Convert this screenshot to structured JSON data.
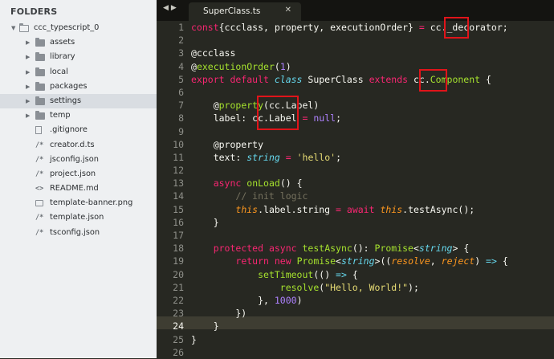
{
  "sidebar": {
    "header": "FOLDERS",
    "items": [
      {
        "label": "ccc_typescript_0",
        "kind": "folder-open",
        "icon": "folder-open-icon"
      },
      {
        "label": "assets",
        "kind": "folder",
        "icon": "folder-icon"
      },
      {
        "label": "library",
        "kind": "folder",
        "icon": "folder-icon"
      },
      {
        "label": "local",
        "kind": "folder",
        "icon": "folder-icon"
      },
      {
        "label": "packages",
        "kind": "folder",
        "icon": "folder-icon"
      },
      {
        "label": "settings",
        "kind": "folder",
        "icon": "folder-icon",
        "selected": true
      },
      {
        "label": "temp",
        "kind": "folder",
        "icon": "folder-icon"
      },
      {
        "label": ".gitignore",
        "kind": "file",
        "glyph": "",
        "icon": "file-icon"
      },
      {
        "label": "creator.d.ts",
        "kind": "file",
        "glyph": "/*",
        "icon": "code-file-icon"
      },
      {
        "label": "jsconfig.json",
        "kind": "file",
        "glyph": "/*",
        "icon": "code-file-icon"
      },
      {
        "label": "project.json",
        "kind": "file",
        "glyph": "/*",
        "icon": "code-file-icon"
      },
      {
        "label": "README.md",
        "kind": "file",
        "glyph": "<>",
        "icon": "markup-file-icon"
      },
      {
        "label": "template-banner.png",
        "kind": "image",
        "icon": "image-file-icon"
      },
      {
        "label": "template.json",
        "kind": "file",
        "glyph": "/*",
        "icon": "code-file-icon"
      },
      {
        "label": "tsconfig.json",
        "kind": "file",
        "glyph": "/*",
        "icon": "code-file-icon"
      }
    ]
  },
  "tabbar": {
    "nav_left": "◀",
    "nav_right": "▶",
    "active_tab": {
      "title": "SuperClass.ts",
      "close": "✕"
    }
  },
  "editor": {
    "current_line": 24,
    "highlight_color": "#e0141a",
    "lines": [
      [
        [
          "kw",
          "const"
        ],
        [
          "",
          "{ccclass, property, executionOrder} "
        ],
        [
          "kw",
          "="
        ],
        [
          "",
          " cc._decorator;"
        ]
      ],
      [],
      [
        [
          "",
          "@ccclass"
        ]
      ],
      [
        [
          "",
          "@"
        ],
        [
          "fn",
          "executionOrder"
        ],
        [
          "",
          "("
        ],
        [
          "num",
          "1"
        ],
        [
          "",
          ")"
        ]
      ],
      [
        [
          "kw",
          "export default "
        ],
        [
          "st",
          "class"
        ],
        [
          "",
          " SuperClass "
        ],
        [
          "kw",
          "extends"
        ],
        [
          "",
          " cc."
        ],
        [
          "fn",
          "Component"
        ],
        [
          "",
          " {"
        ]
      ],
      [],
      [
        [
          "",
          "    @"
        ],
        [
          "fn",
          "property"
        ],
        [
          "",
          "(cc.Label)"
        ]
      ],
      [
        [
          "",
          "    label: cc.Label "
        ],
        [
          "kw",
          "="
        ],
        [
          " "
        ],
        [
          "num",
          "null"
        ],
        [
          "",
          ";"
        ]
      ],
      [],
      [
        [
          "",
          "    @property"
        ]
      ],
      [
        [
          "",
          "    text: "
        ],
        [
          "st",
          "string"
        ],
        [
          "",
          " "
        ],
        [
          "kw",
          "="
        ],
        [
          "",
          " "
        ],
        [
          "str",
          "'hello'"
        ],
        [
          "",
          ";"
        ]
      ],
      [],
      [
        [
          "",
          "    "
        ],
        [
          "kw",
          "async"
        ],
        [
          "",
          " "
        ],
        [
          "fn",
          "onLoad"
        ],
        [
          "",
          "() {"
        ]
      ],
      [
        [
          "",
          "        "
        ],
        [
          "cm",
          "// init logic"
        ]
      ],
      [
        [
          "",
          "        "
        ],
        [
          "this",
          "this"
        ],
        [
          "",
          ".label.string "
        ],
        [
          "kw",
          "="
        ],
        [
          "",
          " "
        ],
        [
          "kw",
          "await"
        ],
        [
          "",
          " "
        ],
        [
          "this",
          "this"
        ],
        [
          "",
          ".testAsync();"
        ]
      ],
      [
        [
          "",
          "    }"
        ]
      ],
      [],
      [
        [
          "",
          "    "
        ],
        [
          "kw",
          "protected async"
        ],
        [
          "",
          " "
        ],
        [
          "fn",
          "testAsync"
        ],
        [
          "",
          "(): "
        ],
        [
          "fn",
          "Promise"
        ],
        [
          "",
          "<"
        ],
        [
          "st",
          "string"
        ],
        [
          "",
          "> {"
        ]
      ],
      [
        [
          "",
          "        "
        ],
        [
          "kw",
          "return new"
        ],
        [
          "",
          " "
        ],
        [
          "fn",
          "Promise"
        ],
        [
          "",
          "<"
        ],
        [
          "st",
          "string"
        ],
        [
          "",
          ">(("
        ],
        [
          "pm",
          "resolve"
        ],
        [
          "",
          ", "
        ],
        [
          "pm",
          "reject"
        ],
        [
          "",
          ") "
        ],
        [
          "st",
          "=>"
        ],
        [
          "",
          " {"
        ]
      ],
      [
        [
          "",
          "            "
        ],
        [
          "fn",
          "setTimeout"
        ],
        [
          "",
          "(() "
        ],
        [
          "st",
          "=>"
        ],
        [
          "",
          " {"
        ]
      ],
      [
        [
          "",
          "                "
        ],
        [
          "fn",
          "resolve"
        ],
        [
          "",
          "("
        ],
        [
          "str",
          "\"Hello, World!\""
        ],
        [
          "",
          ");"
        ]
      ],
      [
        [
          "",
          "            }, "
        ],
        [
          "num",
          "1000"
        ],
        [
          "",
          ")"
        ]
      ],
      [
        [
          "",
          "        })"
        ]
      ],
      [
        [
          "",
          "    }"
        ]
      ],
      [
        [
          "",
          "}"
        ]
      ],
      []
    ]
  }
}
